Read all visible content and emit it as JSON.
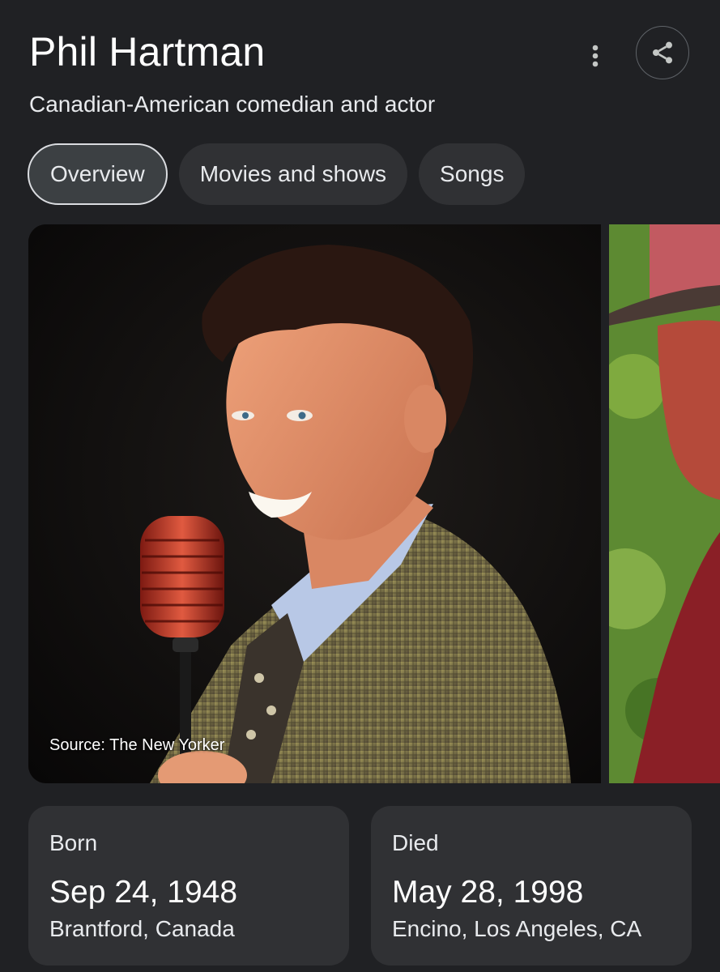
{
  "header": {
    "title": "Phil Hartman",
    "subtitle": "Canadian-American comedian and actor",
    "more_icon": "more-vert-icon",
    "share_icon": "share-icon"
  },
  "tabs": [
    {
      "label": "Overview",
      "active": true
    },
    {
      "label": "Movies and shows",
      "active": false
    },
    {
      "label": "Songs",
      "active": false
    }
  ],
  "images": {
    "main_source": "Source: The New Yorker"
  },
  "facts": {
    "born": {
      "label": "Born",
      "date": "Sep 24, 1948",
      "place": "Brantford, Canada"
    },
    "died": {
      "label": "Died",
      "date": "May 28, 1998",
      "place": "Encino, Los Angeles, CA"
    }
  },
  "colors": {
    "background": "#202124",
    "chip": "#303134",
    "chip_active_border": "#dadce0",
    "text": "#e8eaed"
  }
}
